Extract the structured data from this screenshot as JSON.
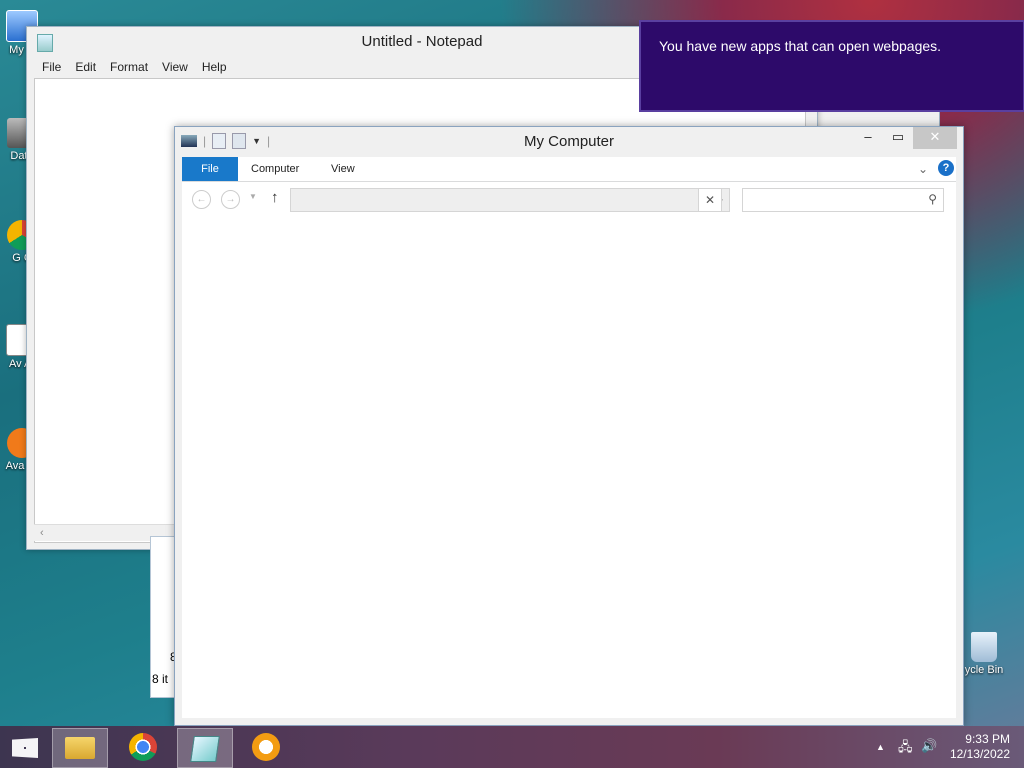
{
  "desktop": {
    "icons": [
      {
        "label": "My C",
        "icon": "computer-icon"
      },
      {
        "label": "Data",
        "icon": "database-icon"
      },
      {
        "label": "G C",
        "icon": "chrome-icon"
      },
      {
        "label": "Av Ar",
        "icon": "app-icon"
      },
      {
        "label": "Ava Br",
        "icon": "avast-icon"
      },
      {
        "label": "ycle Bin",
        "icon": "recycle-bin-icon"
      }
    ]
  },
  "notepad": {
    "title": "Untitled - Notepad",
    "menu": [
      "File",
      "Edit",
      "Format",
      "View",
      "Help"
    ],
    "content": ""
  },
  "background_explorer": {
    "status_left": "8",
    "status_items": "8 it"
  },
  "my_computer": {
    "title": "My Computer",
    "tabs": {
      "file": "File",
      "computer": "Computer",
      "view": "View"
    },
    "address_value": "",
    "search_placeholder": "",
    "help_label": "?"
  },
  "notification": {
    "message": "You have new apps that can open webpages."
  },
  "taskbar": {
    "items": [
      "start-icon",
      "file-explorer-icon",
      "chrome-icon",
      "notepad-icon",
      "avast-secure-browser-icon"
    ],
    "time": "9:33 PM",
    "date": "12/13/2022"
  },
  "colors": {
    "accent": "#1979ca",
    "toast_bg": "#2d0a6a",
    "taskbar": "#5a3a5a"
  }
}
